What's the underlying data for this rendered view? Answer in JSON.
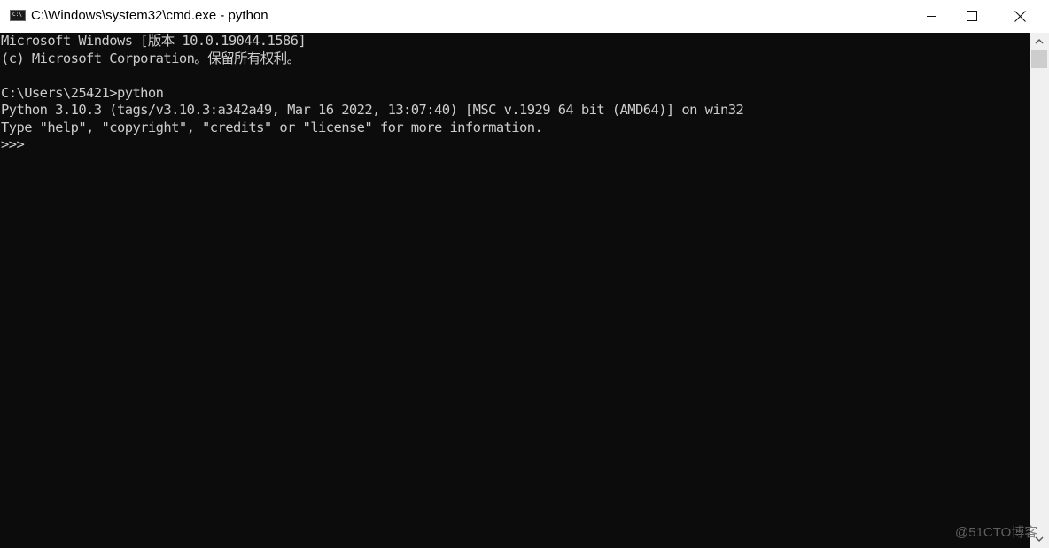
{
  "window": {
    "title": "C:\\Windows\\system32\\cmd.exe - python",
    "icon_label": "C:\\",
    "controls": {
      "minimize": "minimize",
      "maximize": "maximize",
      "close": "close"
    }
  },
  "console": {
    "lines": [
      "Microsoft Windows [版本 10.0.19044.1586]",
      "(c) Microsoft Corporation。保留所有权利。",
      "",
      "C:\\Users\\25421>python",
      "Python 3.10.3 (tags/v3.10.3:a342a49, Mar 16 2022, 13:07:40) [MSC v.1929 64 bit (AMD64)] on win32",
      "Type \"help\", \"copyright\", \"credits\" or \"license\" for more information.",
      ">>> "
    ],
    "text_color": "#cccccc",
    "background": "#0c0c0c"
  },
  "watermark": "@51CTO博客"
}
